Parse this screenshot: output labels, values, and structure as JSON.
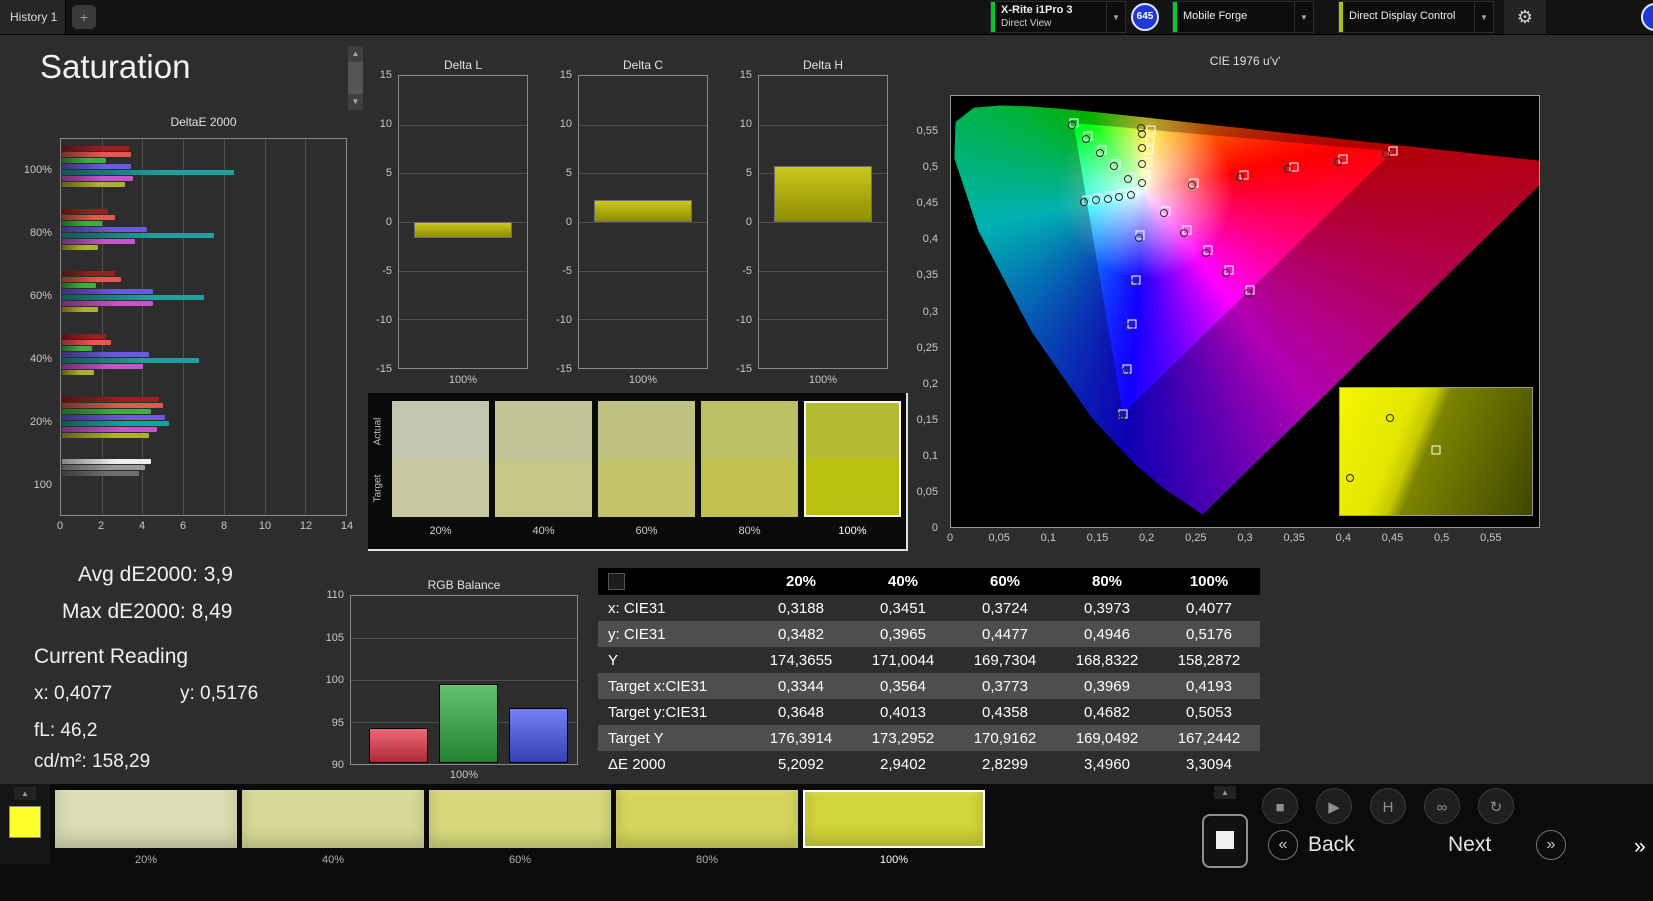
{
  "app": {
    "tabs": [
      {
        "label": "History 1"
      }
    ],
    "add_tab_label": "+",
    "meter_dropdown": {
      "line1": "X-Rite i1Pro 3",
      "line2": "Direct View",
      "accent": "#00c832"
    },
    "badge": {
      "value": "645",
      "bg": "#1d39d8"
    },
    "pattern_dropdown": {
      "label": "Mobile Forge",
      "accent": "#00c832"
    },
    "control_dropdown": {
      "label": "Direct Display Control",
      "accent": "#a0c800"
    },
    "chevron": "▼",
    "gear": "⚙"
  },
  "page": {
    "title": "Saturation"
  },
  "deltae": {
    "title": "DeltaE 2000",
    "xticks": [
      "0",
      "2",
      "4",
      "6",
      "8",
      "10",
      "12",
      "14"
    ],
    "xmax": 14,
    "groups": [
      {
        "label": "100%",
        "bars": [
          {
            "c": "#9b1f1f",
            "v": 3.3
          },
          {
            "c": "#e05a50",
            "v": 3.4
          },
          {
            "c": "#3fae3f",
            "v": 2.2
          },
          {
            "c": "#6a5ae0",
            "v": 3.4
          },
          {
            "c": "#1fa0a0",
            "v": 8.49
          },
          {
            "c": "#c855c8",
            "v": 3.5
          },
          {
            "c": "#b0b030",
            "v": 3.1
          }
        ]
      },
      {
        "label": "80%",
        "bars": [
          {
            "c": "#9b1f1f",
            "v": 2.3
          },
          {
            "c": "#e05a50",
            "v": 2.6
          },
          {
            "c": "#3fae3f",
            "v": 2.0
          },
          {
            "c": "#6a5ae0",
            "v": 4.2
          },
          {
            "c": "#1fa0a0",
            "v": 7.5
          },
          {
            "c": "#c855c8",
            "v": 3.6
          },
          {
            "c": "#b0b030",
            "v": 1.8
          }
        ]
      },
      {
        "label": "60%",
        "bars": [
          {
            "c": "#9b1f1f",
            "v": 2.6
          },
          {
            "c": "#e05a50",
            "v": 2.9
          },
          {
            "c": "#3fae3f",
            "v": 1.7
          },
          {
            "c": "#6a5ae0",
            "v": 4.5
          },
          {
            "c": "#1fa0a0",
            "v": 7.0
          },
          {
            "c": "#c855c8",
            "v": 4.5
          },
          {
            "c": "#b0b030",
            "v": 1.8
          }
        ]
      },
      {
        "label": "40%",
        "bars": [
          {
            "c": "#9b1f1f",
            "v": 2.2
          },
          {
            "c": "#e05a50",
            "v": 2.4
          },
          {
            "c": "#3fae3f",
            "v": 1.5
          },
          {
            "c": "#6a5ae0",
            "v": 4.3
          },
          {
            "c": "#1fa0a0",
            "v": 6.8
          },
          {
            "c": "#c855c8",
            "v": 4.0
          },
          {
            "c": "#b0b030",
            "v": 1.6
          }
        ]
      },
      {
        "label": "20%",
        "bars": [
          {
            "c": "#9b1f1f",
            "v": 4.8
          },
          {
            "c": "#e05a50",
            "v": 5.0
          },
          {
            "c": "#3fae3f",
            "v": 4.4
          },
          {
            "c": "#6a5ae0",
            "v": 5.1
          },
          {
            "c": "#1fa0a0",
            "v": 5.3
          },
          {
            "c": "#c855c8",
            "v": 4.7
          },
          {
            "c": "#b0b030",
            "v": 4.3
          }
        ]
      },
      {
        "label": "100",
        "bars": [
          {
            "c": "#ededed",
            "v": 4.4
          },
          {
            "c": "#9a9a9a",
            "v": 4.1
          },
          {
            "c": "#6e6e6e",
            "v": 3.8
          }
        ]
      }
    ]
  },
  "delta_bars": {
    "yticks": [
      "15",
      "10",
      "5",
      "0",
      "-5",
      "-10",
      "-15"
    ],
    "ymax": 15,
    "xlabel": "100%",
    "charts": [
      {
        "title": "Delta L",
        "value": -1.6
      },
      {
        "title": "Delta C",
        "value": 2.3
      },
      {
        "title": "Delta H",
        "value": 5.8
      }
    ]
  },
  "swatches": {
    "row_labels": [
      "Actual",
      "Target"
    ],
    "items": [
      {
        "label": "20%",
        "actual": "#c3c6ae",
        "target": "#c8c8a0"
      },
      {
        "label": "40%",
        "actual": "#c1c497",
        "target": "#c6c687"
      },
      {
        "label": "60%",
        "actual": "#bfc281",
        "target": "#c3c36c"
      },
      {
        "label": "80%",
        "actual": "#bcbf62",
        "target": "#c0c14e"
      },
      {
        "label": "100%",
        "actual": "#b2bb31",
        "target": "#bac00f"
      }
    ],
    "selected_index": 4
  },
  "cie": {
    "title": "CIE 1976 u'v'",
    "xticks": [
      "0",
      "0,05",
      "0,1",
      "0,15",
      "0,2",
      "0,25",
      "0,3",
      "0,35",
      "0,4",
      "0,45",
      "0,5",
      "0,55"
    ],
    "yticks": [
      "0",
      "0,05",
      "0,1",
      "0,15",
      "0,2",
      "0,25",
      "0,3",
      "0,35",
      "0,4",
      "0,45",
      "0,5",
      "0,55"
    ],
    "axis_max": 0.6,
    "tick_step": 0.05,
    "white_point": [
      0.1978,
      0.4683
    ],
    "locus": [
      [
        0.2568,
        0.0172
      ],
      [
        0.2161,
        0.0549
      ],
      [
        0.1877,
        0.0871
      ],
      [
        0.1441,
        0.151
      ],
      [
        0.0828,
        0.2708
      ],
      [
        0.0282,
        0.4117
      ],
      [
        0.0035,
        0.5131
      ],
      [
        0.0046,
        0.5639
      ],
      [
        0.0231,
        0.5837
      ],
      [
        0.0501,
        0.5868
      ],
      [
        0.0792,
        0.5856
      ],
      [
        0.1127,
        0.5821
      ],
      [
        0.1531,
        0.5766
      ],
      [
        0.2026,
        0.5694
      ],
      [
        0.2623,
        0.5604
      ],
      [
        0.3315,
        0.5501
      ],
      [
        0.4035,
        0.5393
      ],
      [
        0.4692,
        0.5296
      ],
      [
        0.5203,
        0.5219
      ],
      [
        0.5565,
        0.5165
      ],
      [
        0.6005,
        0.5099
      ],
      [
        0.6234,
        0.5065
      ]
    ],
    "triangle": [
      [
        0.4507,
        0.5229
      ],
      [
        0.125,
        0.5625
      ],
      [
        0.1754,
        0.1579
      ]
    ],
    "targets": [
      [
        0.2484,
        0.4792
      ],
      [
        0.299,
        0.4901
      ],
      [
        0.3495,
        0.5011
      ],
      [
        0.4001,
        0.512
      ],
      [
        0.4507,
        0.5229
      ],
      [
        0.1832,
        0.4871
      ],
      [
        0.1687,
        0.506
      ],
      [
        0.1541,
        0.5248
      ],
      [
        0.1396,
        0.5437
      ],
      [
        0.125,
        0.5625
      ],
      [
        0.1933,
        0.4062
      ],
      [
        0.1888,
        0.3441
      ],
      [
        0.1844,
        0.2821
      ],
      [
        0.1799,
        0.22
      ],
      [
        0.1754,
        0.1579
      ],
      [
        0.1859,
        0.4657
      ],
      [
        0.174,
        0.4632
      ],
      [
        0.1622,
        0.4606
      ],
      [
        0.1503,
        0.4581
      ],
      [
        0.1384,
        0.4555
      ],
      [
        0.2192,
        0.4406
      ],
      [
        0.2407,
        0.4129
      ],
      [
        0.2621,
        0.3852
      ],
      [
        0.2836,
        0.3575
      ],
      [
        0.305,
        0.3298
      ],
      [
        0.1994,
        0.4894
      ],
      [
        0.2007,
        0.5085
      ],
      [
        0.2019,
        0.5247
      ],
      [
        0.2029,
        0.5385
      ],
      [
        0.2039,
        0.5529
      ]
    ],
    "measurements": [
      [
        0.2455,
        0.476
      ],
      [
        0.295,
        0.487
      ],
      [
        0.344,
        0.498
      ],
      [
        0.395,
        0.508
      ],
      [
        0.444,
        0.519
      ],
      [
        0.1805,
        0.484
      ],
      [
        0.166,
        0.502
      ],
      [
        0.152,
        0.521
      ],
      [
        0.138,
        0.54
      ],
      [
        0.123,
        0.559
      ],
      [
        0.1915,
        0.403
      ],
      [
        0.187,
        0.34
      ],
      [
        0.183,
        0.279
      ],
      [
        0.1785,
        0.217
      ],
      [
        0.174,
        0.156
      ],
      [
        0.1835,
        0.462
      ],
      [
        0.1715,
        0.46
      ],
      [
        0.16,
        0.457
      ],
      [
        0.148,
        0.455
      ],
      [
        0.136,
        0.452
      ],
      [
        0.217,
        0.437
      ],
      [
        0.238,
        0.409
      ],
      [
        0.26,
        0.381
      ],
      [
        0.281,
        0.354
      ],
      [
        0.303,
        0.326
      ],
      [
        0.195,
        0.479
      ],
      [
        0.1953,
        0.5049
      ],
      [
        0.1953,
        0.5282
      ],
      [
        0.1952,
        0.5468
      ],
      [
        0.1942,
        0.5548
      ]
    ],
    "inset": {
      "squares": [
        [
          50,
          49
        ]
      ],
      "circles": [
        [
          26,
          24
        ],
        [
          5,
          71
        ]
      ]
    }
  },
  "readings": {
    "avg": "Avg dE2000: 3,9",
    "max": "Max dE2000: 8,49",
    "heading": "Current Reading",
    "x": "x: 0,4077",
    "y": "y: 0,5176",
    "fl": "fL: 46,2",
    "cdm2": "cd/m²: 158,29"
  },
  "rgb": {
    "title": "RGB Balance",
    "yticks": [
      "110",
      "105",
      "100",
      "95",
      "90"
    ],
    "ymin": 90,
    "ymax": 110,
    "xlabel": "100%",
    "bars": [
      {
        "name": "red",
        "color": "#e8374a",
        "value": 94.2
      },
      {
        "name": "green",
        "color": "#2fae3e",
        "value": 99.4
      },
      {
        "name": "blue",
        "color": "#4656f0",
        "value": 96.6
      }
    ]
  },
  "table": {
    "col_headers": [
      "20%",
      "40%",
      "60%",
      "80%",
      "100%"
    ],
    "rows": [
      {
        "label": "x: CIE31",
        "values": [
          "0,3188",
          "0,3451",
          "0,3724",
          "0,3973",
          "0,4077"
        ]
      },
      {
        "label": "y: CIE31",
        "values": [
          "0,3482",
          "0,3965",
          "0,4477",
          "0,4946",
          "0,5176"
        ]
      },
      {
        "label": "Y",
        "values": [
          "174,3655",
          "171,0044",
          "169,7304",
          "168,8322",
          "158,2872"
        ]
      },
      {
        "label": "Target x:CIE31",
        "values": [
          "0,3344",
          "0,3564",
          "0,3773",
          "0,3969",
          "0,4193"
        ]
      },
      {
        "label": "Target y:CIE31",
        "values": [
          "0,3648",
          "0,4013",
          "0,4358",
          "0,4682",
          "0,5053"
        ]
      },
      {
        "label": "Target Y",
        "values": [
          "176,3914",
          "173,2952",
          "170,9162",
          "169,0492",
          "167,2442"
        ]
      },
      {
        "label": "ΔE 2000",
        "values": [
          "5,2092",
          "2,9402",
          "2,8299",
          "3,4960",
          "3,3094"
        ]
      }
    ]
  },
  "bottom": {
    "current_swatch": "#ffff2e",
    "swatches": [
      {
        "label": "20%",
        "color": "#dadcb2"
      },
      {
        "label": "40%",
        "color": "#d8d996"
      },
      {
        "label": "60%",
        "color": "#d6d87a"
      },
      {
        "label": "80%",
        "color": "#d4d65c"
      },
      {
        "label": "100%",
        "color": "#d1d538"
      }
    ],
    "selected_index": 4,
    "transport": [
      {
        "name": "stop",
        "glyph": "■"
      },
      {
        "name": "play",
        "glyph": "▶"
      },
      {
        "name": "hold",
        "glyph": "H"
      },
      {
        "name": "continuous",
        "glyph": "∞"
      },
      {
        "name": "refresh",
        "glyph": "↻"
      }
    ],
    "back_label": "Back",
    "next_label": "Next",
    "prev_glyph": "«",
    "next_glyph": "»"
  }
}
